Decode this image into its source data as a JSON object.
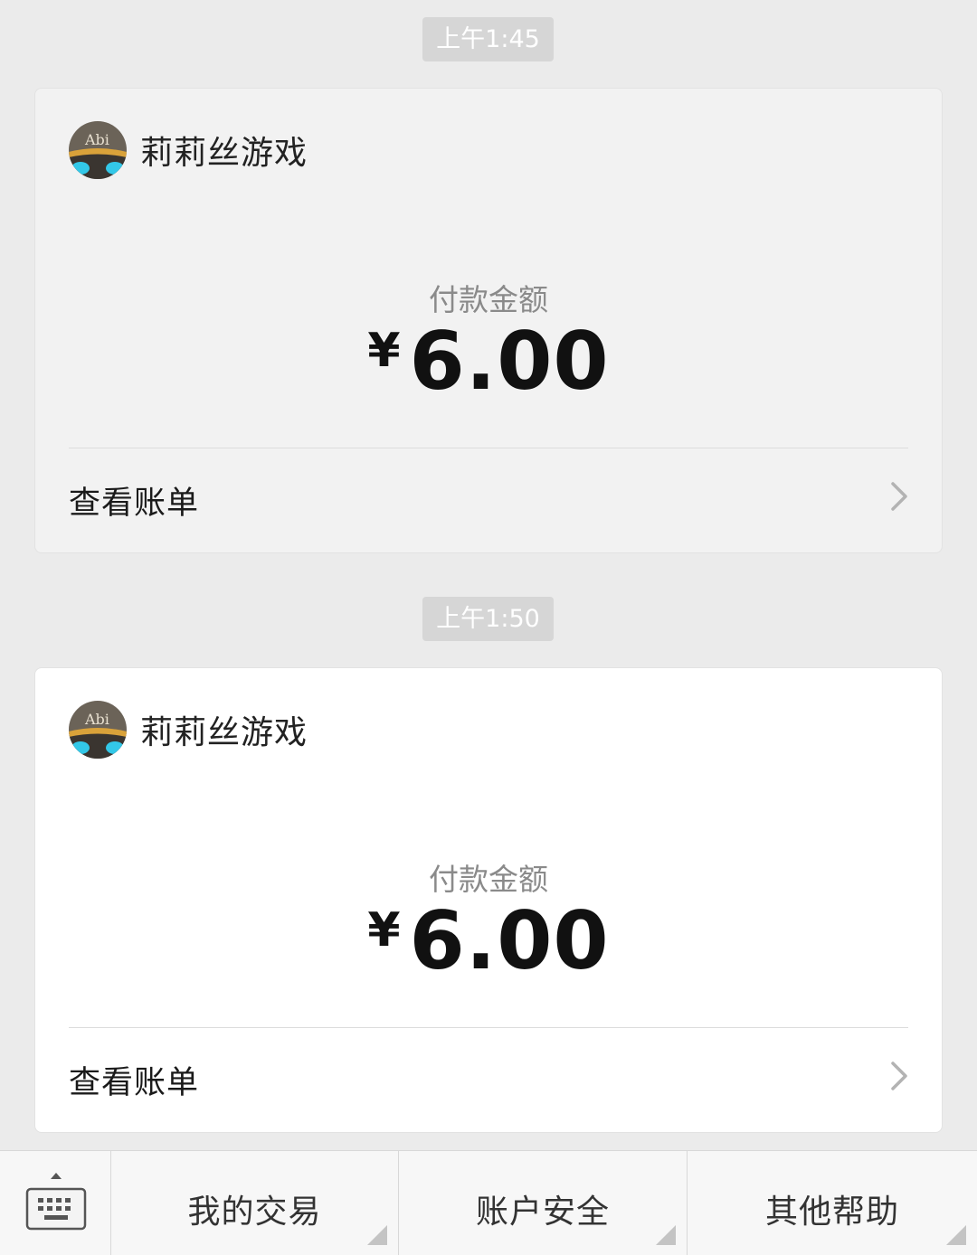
{
  "colors": {
    "background": "#ebebeb",
    "card_dim": "#f2f2f2",
    "card_active": "#ffffff",
    "timestamp_bg": "#d6d6d6",
    "amount_text": "#111111",
    "label_gray": "#8a8a8a"
  },
  "messages": [
    {
      "timestamp": "上午1:45",
      "merchant": {
        "name": "莉莉丝游戏",
        "avatar_icon": "lilith-games-logo-icon",
        "avatar_text": "Abi"
      },
      "amount_label": "付款金额",
      "currency": "¥",
      "amount": "6.00",
      "bill_link": "查看账单",
      "chevron_icon": "chevron-right-icon"
    },
    {
      "timestamp": "上午1:50",
      "merchant": {
        "name": "莉莉丝游戏",
        "avatar_icon": "lilith-games-logo-icon",
        "avatar_text": "Abi"
      },
      "amount_label": "付款金额",
      "currency": "¥",
      "amount": "6.00",
      "bill_link": "查看账单",
      "chevron_icon": "chevron-right-icon"
    }
  ],
  "bottom_menu": {
    "keyboard_icon": "keyboard-toggle-icon",
    "items": [
      {
        "label": "我的交易",
        "submenu_icon": "submenu-corner-icon"
      },
      {
        "label": "账户安全",
        "submenu_icon": "submenu-corner-icon"
      },
      {
        "label": "其他帮助",
        "submenu_icon": "submenu-corner-icon"
      }
    ]
  }
}
